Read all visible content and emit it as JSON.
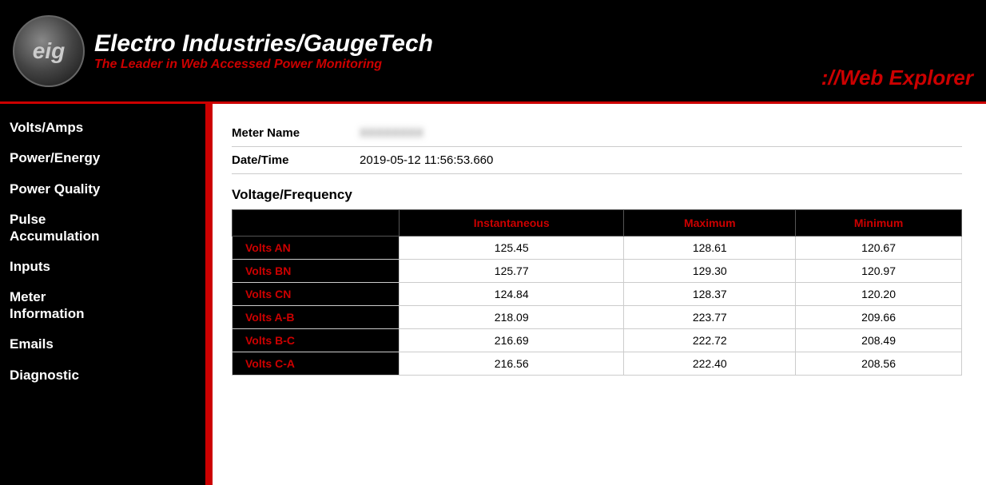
{
  "header": {
    "company_name": "Electro Industries/GaugeTech",
    "tagline": "The Leader in Web Accessed Power Monitoring",
    "app_name": "Web Explorer",
    "app_prefix": "://"
  },
  "sidebar": {
    "items": [
      {
        "id": "volts-amps",
        "label": "Volts/Amps"
      },
      {
        "id": "power-energy",
        "label": "Power/Energy"
      },
      {
        "id": "power-quality",
        "label": "Power Quality"
      },
      {
        "id": "pulse-accumulation",
        "label": "Pulse Accumulation"
      },
      {
        "id": "inputs",
        "label": "Inputs"
      },
      {
        "id": "meter-information",
        "label": "Meter Information"
      },
      {
        "id": "emails",
        "label": "Emails"
      },
      {
        "id": "diagnostic",
        "label": "Diagnostic"
      }
    ]
  },
  "content": {
    "meter_name_label": "Meter Name",
    "meter_name_value": "XXXXXXXX",
    "datetime_label": "Date/Time",
    "datetime_value": "2019-05-12 11:56:53.660",
    "section_title": "Voltage/Frequency",
    "table": {
      "headers": [
        "",
        "Instantaneous",
        "Maximum",
        "Minimum"
      ],
      "rows": [
        {
          "label": "Volts AN",
          "instantaneous": "125.45",
          "maximum": "128.61",
          "minimum": "120.67"
        },
        {
          "label": "Volts BN",
          "instantaneous": "125.77",
          "maximum": "129.30",
          "minimum": "120.97"
        },
        {
          "label": "Volts CN",
          "instantaneous": "124.84",
          "maximum": "128.37",
          "minimum": "120.20"
        },
        {
          "label": "Volts A-B",
          "instantaneous": "218.09",
          "maximum": "223.77",
          "minimum": "209.66"
        },
        {
          "label": "Volts B-C",
          "instantaneous": "216.69",
          "maximum": "222.72",
          "minimum": "208.49"
        },
        {
          "label": "Volts C-A",
          "instantaneous": "216.56",
          "maximum": "222.40",
          "minimum": "208.56"
        }
      ]
    }
  }
}
